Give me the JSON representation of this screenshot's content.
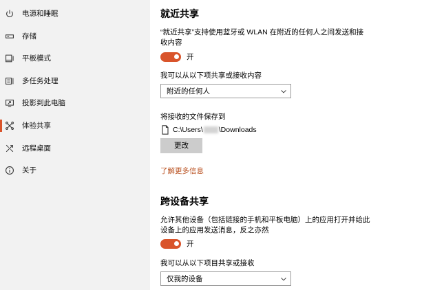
{
  "sidebar": {
    "items": [
      {
        "label": "电源和睡眠",
        "icon": "power-icon",
        "selected": false
      },
      {
        "label": "存储",
        "icon": "storage-icon",
        "selected": false
      },
      {
        "label": "平板模式",
        "icon": "tablet-mode-icon",
        "selected": false
      },
      {
        "label": "多任务处理",
        "icon": "multitasking-icon",
        "selected": false
      },
      {
        "label": "投影到此电脑",
        "icon": "projecting-icon",
        "selected": false
      },
      {
        "label": "体验共享",
        "icon": "shared-experiences-icon",
        "selected": true
      },
      {
        "label": "远程桌面",
        "icon": "remote-desktop-icon",
        "selected": false
      },
      {
        "label": "关于",
        "icon": "about-icon",
        "selected": false
      }
    ]
  },
  "nearby_sharing": {
    "title": "就近共享",
    "description": "“就近共享”支持使用蓝牙或 WLAN 在附近的任何人之间发送和接收内容",
    "toggle": {
      "is_on": true,
      "label": "开"
    },
    "share_with_label": "我可以从以下项共享或接收内容",
    "share_with_selected": "附近的任何人",
    "save_location_label": "将接收的文件保存到",
    "save_path_prefix": "C:\\Users\\",
    "save_path_suffix": "\\Downloads",
    "change_button": "更改",
    "learn_more_link": "了解更多信息"
  },
  "cross_device_sharing": {
    "title": "跨设备共享",
    "description": "允许其他设备（包括链接的手机和平板电脑）上的应用打开并给此设备上的应用发送消息，反之亦然",
    "toggle": {
      "is_on": true,
      "label": "开"
    },
    "share_with_label": "我可以从以下项目共享或接收",
    "share_with_selected": "仅我的设备"
  },
  "colors": {
    "accent": "#d9542b",
    "link": "#b9501f",
    "sidebar_bg": "#f2f2f2",
    "button_bg": "#cccccc"
  }
}
